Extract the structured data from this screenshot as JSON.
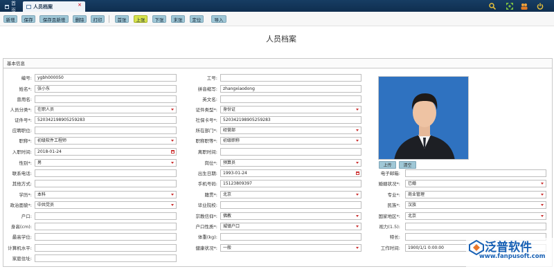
{
  "tabs": {
    "home": "首页",
    "active": "人员档案",
    "close": "×"
  },
  "toolbar": [
    "新增",
    "保存",
    "保存且新增",
    "删除",
    "打印",
    "首张",
    "上张",
    "下张",
    "末张",
    "定位",
    "导入"
  ],
  "title": "人员档案",
  "section": "基本信息",
  "photo_buttons": [
    "上传",
    "清空"
  ],
  "watermark": {
    "text": "泛普软件",
    "url": "www.fanpusoft.com"
  },
  "col1": [
    {
      "label": "编号:",
      "value": "ygbh000050",
      "type": "text"
    },
    {
      "label": "姓名*:",
      "value": "张小东",
      "type": "text"
    },
    {
      "label": "曾用名:",
      "value": "",
      "type": "text"
    },
    {
      "label": "人员分类*:",
      "value": "在职人员",
      "type": "select"
    },
    {
      "label": "证件号*:",
      "value": "520342198905259283",
      "type": "text"
    },
    {
      "label": "应聘职位:",
      "value": "",
      "type": "text"
    },
    {
      "label": "职称*:",
      "value": "初级软件工程师",
      "type": "select"
    },
    {
      "label": "入职时间:",
      "value": "2018-01-24",
      "type": "date"
    },
    {
      "label": "性别*:",
      "value": "男",
      "type": "select"
    },
    {
      "label": "联系电话:",
      "value": "",
      "type": "text"
    },
    {
      "label": "其他方式:",
      "value": "",
      "type": "text"
    },
    {
      "label": "学历*:",
      "value": "本科",
      "type": "select"
    },
    {
      "label": "政治面貌*:",
      "value": "中共党员",
      "type": "select"
    },
    {
      "label": "户口:",
      "value": "",
      "type": "text"
    },
    {
      "label": "身高(cm):",
      "value": "",
      "type": "text"
    },
    {
      "label": "最高学位:",
      "value": "",
      "type": "text"
    },
    {
      "label": "计算机水平:",
      "value": "",
      "type": "text"
    },
    {
      "label": "家庭住址:",
      "value": "",
      "type": "text"
    }
  ],
  "col2": [
    {
      "label": "工号:",
      "value": "",
      "type": "text"
    },
    {
      "label": "拼音缩写:",
      "value": "zhangxiaodong",
      "type": "text"
    },
    {
      "label": "英文名:",
      "value": "",
      "type": "text"
    },
    {
      "label": "证件类型*:",
      "value": "身份证",
      "type": "select"
    },
    {
      "label": "社保卡号*:",
      "value": "520342198905259283",
      "type": "text"
    },
    {
      "label": "所在部门*:",
      "value": "经营部",
      "type": "select"
    },
    {
      "label": "职称职等*:",
      "value": "初级职称",
      "type": "select"
    },
    {
      "label": "离职时间:",
      "value": "",
      "type": "text"
    },
    {
      "label": "岗位*:",
      "value": "预算员",
      "type": "select"
    },
    {
      "label": "出生日期:",
      "value": "1993-01-24",
      "type": "date"
    },
    {
      "label": "手机号码:",
      "value": "15123809397",
      "type": "text"
    },
    {
      "label": "籍贯*:",
      "value": "北京",
      "type": "select"
    },
    {
      "label": "毕业院校:",
      "value": "",
      "type": "text"
    },
    {
      "label": "宗教信仰*:",
      "value": "佛教",
      "type": "select"
    },
    {
      "label": "户口性质*:",
      "value": "城镇户口",
      "type": "select"
    },
    {
      "label": "体重(kg):",
      "value": "",
      "type": "text"
    },
    {
      "label": "健康状况*:",
      "value": "一般",
      "type": "select"
    }
  ],
  "col3": [
    {
      "label": "电子邮箱:",
      "value": "",
      "type": "text"
    },
    {
      "label": "婚姻状况*:",
      "value": "已婚",
      "type": "select"
    },
    {
      "label": "专业*:",
      "value": "商业管理",
      "type": "select"
    },
    {
      "label": "民族*:",
      "value": "汉族",
      "type": "select"
    },
    {
      "label": "国家地区*:",
      "value": "北京",
      "type": "select"
    },
    {
      "label": "视力(1.5):",
      "value": "",
      "type": "text"
    },
    {
      "label": "特长:",
      "value": "",
      "type": "text"
    },
    {
      "label": "工作时间:",
      "value": "1900/1/1 0:00:00",
      "type": "text"
    }
  ]
}
